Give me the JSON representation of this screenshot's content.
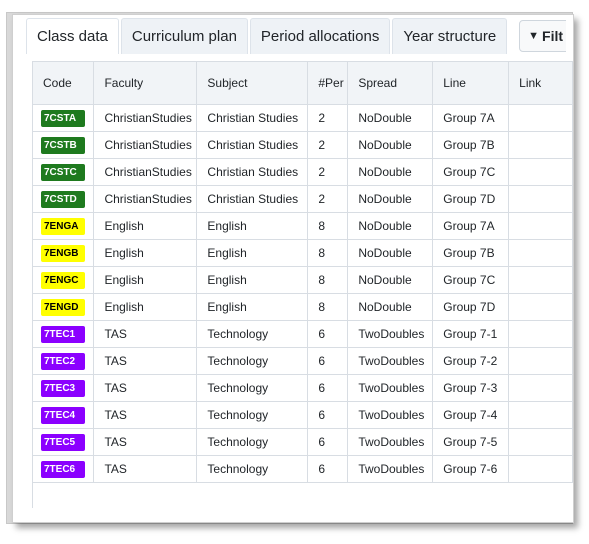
{
  "tabs": [
    "Class data",
    "Curriculum plan",
    "Period allocations",
    "Year structure"
  ],
  "active_tab": 0,
  "filter_label": "Filt",
  "columns": [
    "Code",
    "Faculty",
    "Subject",
    "#Per",
    "Spread",
    "Line",
    "Link"
  ],
  "faculty_colors": {
    "ChristianStudies": {
      "bg": "#1e7a1e",
      "fg": "#ffffff"
    },
    "English": {
      "bg": "#ffff00",
      "fg": "#000000"
    },
    "TAS": {
      "bg": "#8b00ff",
      "fg": "#ffffff"
    }
  },
  "rows": [
    {
      "code": "7CSTA",
      "faculty": "ChristianStudies",
      "subject": "Christian Studies",
      "per": "2",
      "spread": "NoDouble",
      "line": "Group 7A",
      "link": ""
    },
    {
      "code": "7CSTB",
      "faculty": "ChristianStudies",
      "subject": "Christian Studies",
      "per": "2",
      "spread": "NoDouble",
      "line": "Group 7B",
      "link": ""
    },
    {
      "code": "7CSTC",
      "faculty": "ChristianStudies",
      "subject": "Christian Studies",
      "per": "2",
      "spread": "NoDouble",
      "line": "Group 7C",
      "link": ""
    },
    {
      "code": "7CSTD",
      "faculty": "ChristianStudies",
      "subject": "Christian Studies",
      "per": "2",
      "spread": "NoDouble",
      "line": "Group 7D",
      "link": ""
    },
    {
      "code": "7ENGA",
      "faculty": "English",
      "subject": "English",
      "per": "8",
      "spread": "NoDouble",
      "line": "Group 7A",
      "link": ""
    },
    {
      "code": "7ENGB",
      "faculty": "English",
      "subject": "English",
      "per": "8",
      "spread": "NoDouble",
      "line": "Group 7B",
      "link": ""
    },
    {
      "code": "7ENGC",
      "faculty": "English",
      "subject": "English",
      "per": "8",
      "spread": "NoDouble",
      "line": "Group 7C",
      "link": ""
    },
    {
      "code": "7ENGD",
      "faculty": "English",
      "subject": "English",
      "per": "8",
      "spread": "NoDouble",
      "line": "Group 7D",
      "link": ""
    },
    {
      "code": "7TEC1",
      "faculty": "TAS",
      "subject": "Technology",
      "per": "6",
      "spread": "TwoDoubles",
      "line": "Group 7-1",
      "link": ""
    },
    {
      "code": "7TEC2",
      "faculty": "TAS",
      "subject": "Technology",
      "per": "6",
      "spread": "TwoDoubles",
      "line": "Group 7-2",
      "link": ""
    },
    {
      "code": "7TEC3",
      "faculty": "TAS",
      "subject": "Technology",
      "per": "6",
      "spread": "TwoDoubles",
      "line": "Group 7-3",
      "link": ""
    },
    {
      "code": "7TEC4",
      "faculty": "TAS",
      "subject": "Technology",
      "per": "6",
      "spread": "TwoDoubles",
      "line": "Group 7-4",
      "link": ""
    },
    {
      "code": "7TEC5",
      "faculty": "TAS",
      "subject": "Technology",
      "per": "6",
      "spread": "TwoDoubles",
      "line": "Group 7-5",
      "link": ""
    },
    {
      "code": "7TEC6",
      "faculty": "TAS",
      "subject": "Technology",
      "per": "6",
      "spread": "TwoDoubles",
      "line": "Group 7-6",
      "link": ""
    }
  ]
}
